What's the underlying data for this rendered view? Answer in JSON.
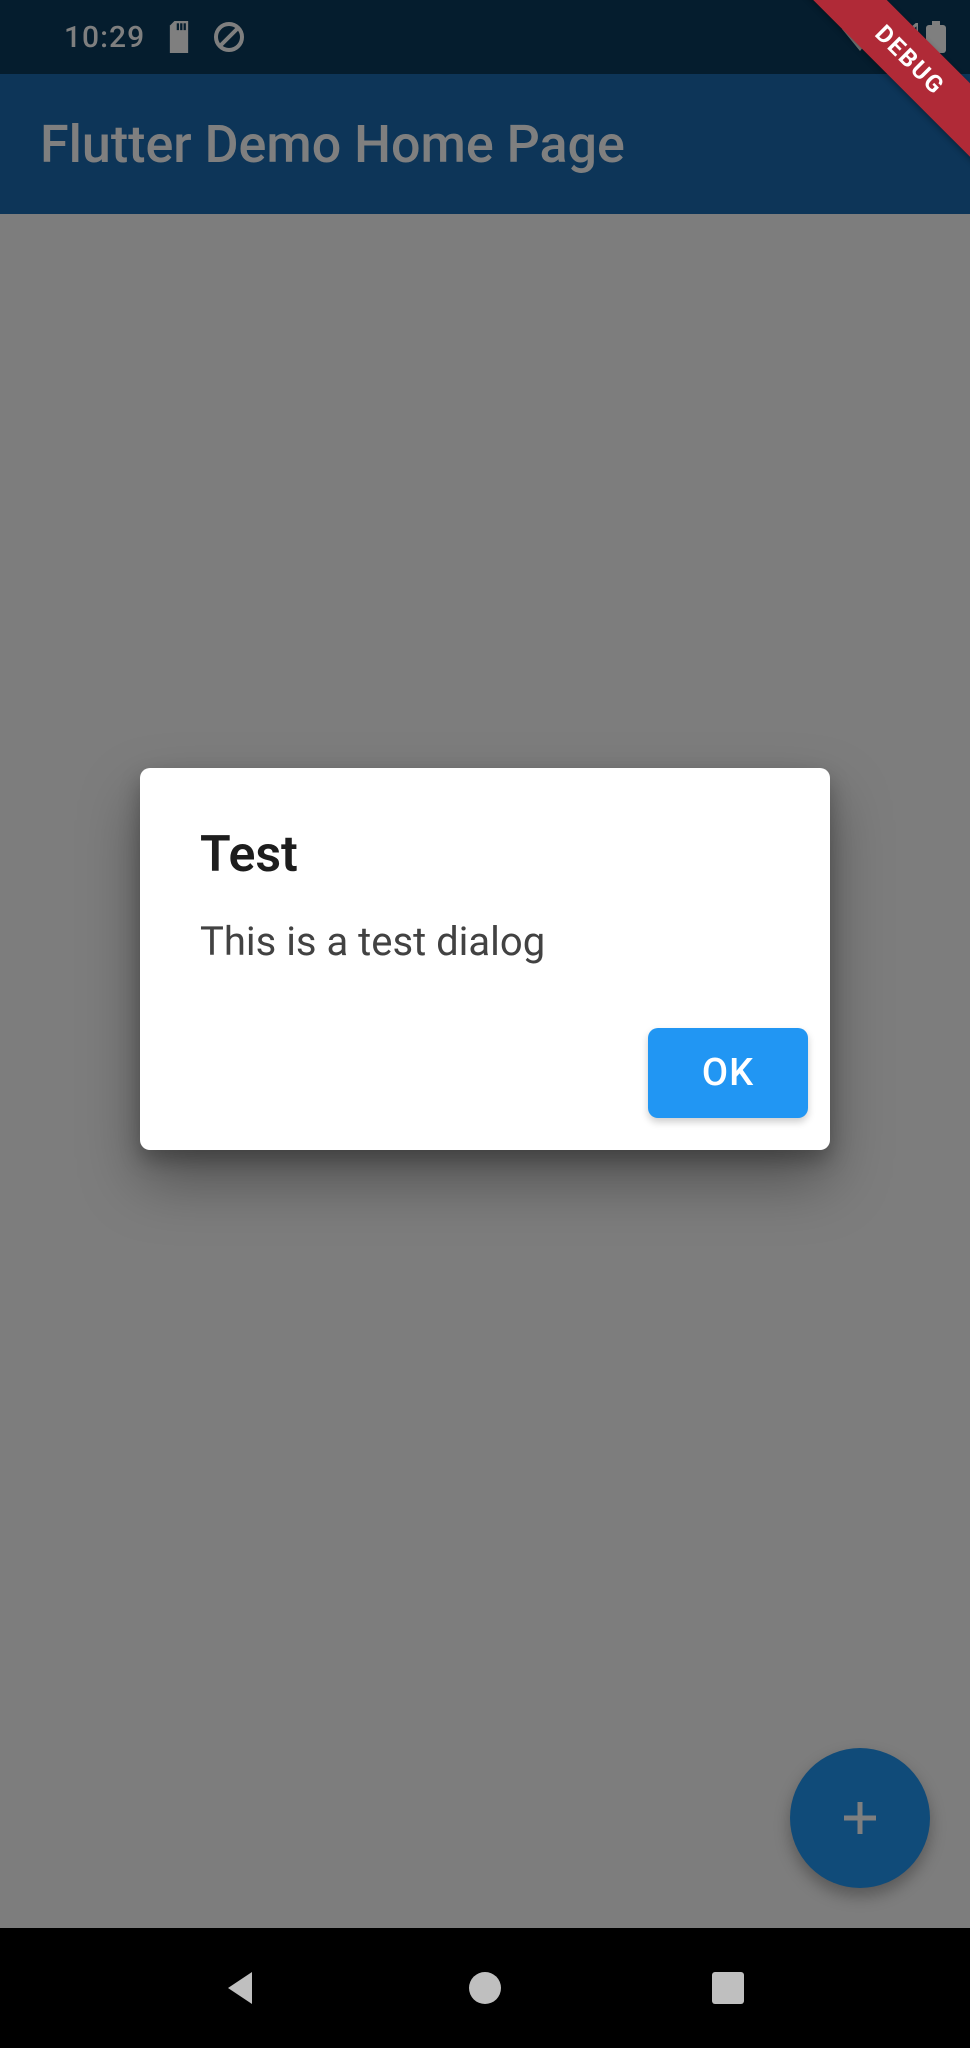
{
  "status": {
    "time": "10:29"
  },
  "appbar": {
    "title": "Flutter Demo Home Page"
  },
  "dialog": {
    "title": "Test",
    "content": "This is a test dialog",
    "ok_label": "OK"
  },
  "debug": {
    "label": "DEBUG"
  },
  "colors": {
    "primary": "#2196f3",
    "appbar": "#1a6bb0",
    "statusbar": "#0a3a5c",
    "debug_banner": "#b02a37"
  }
}
